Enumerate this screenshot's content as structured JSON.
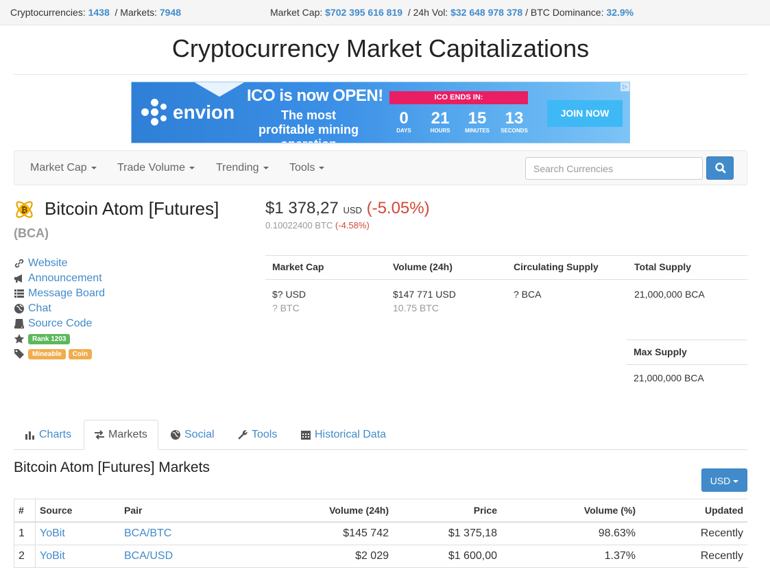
{
  "topbar": {
    "crypto_label": "Cryptocurrencies:",
    "crypto_count": "1438",
    "markets_label": "/ Markets:",
    "markets_count": "7948",
    "mcap_label": "Market Cap:",
    "mcap_value": "$702 395 616 819",
    "vol_label": "/ 24h Vol:",
    "vol_value": "$32 648 978 378",
    "dom_label": "/ BTC Dominance:",
    "dom_value": "32.9%"
  },
  "page_title": "Cryptocurrency Market Capitalizations",
  "banner": {
    "brand": "envion",
    "headline": "ICO is now OPEN!",
    "subline": "The most profitable mining operation",
    "ends_label": "ICO ENDS IN:",
    "countdown": [
      {
        "num": "0",
        "label": "DAYS"
      },
      {
        "num": "21",
        "label": "HOURS"
      },
      {
        "num": "15",
        "label": "MINUTES"
      },
      {
        "num": "13",
        "label": "SECONDS"
      }
    ],
    "cta": "JOIN NOW"
  },
  "nav": {
    "items": [
      "Market Cap",
      "Trade Volume",
      "Trending",
      "Tools"
    ],
    "search_placeholder": "Search Currencies"
  },
  "coin": {
    "name": "Bitcoin Atom [Futures]",
    "symbol": "(BCA)",
    "price_usd": "$1 378,27",
    "price_unit": "USD",
    "change_usd": "(-5.05%)",
    "price_btc": "0.10022400 BTC",
    "change_btc": "(-4.58%)",
    "links": [
      "Website",
      "Announcement",
      "Message Board",
      "Chat",
      "Source Code"
    ],
    "rank": "Rank 1203",
    "tags": [
      "Mineable",
      "Coin"
    ]
  },
  "stats": {
    "headers": [
      "Market Cap",
      "Volume (24h)",
      "Circulating Supply",
      "Total Supply"
    ],
    "market_cap_usd": "$? USD",
    "market_cap_btc": "? BTC",
    "volume_usd": "$147 771 USD",
    "volume_btc": "10.75 BTC",
    "circulating": "? BCA",
    "total": "21,000,000 BCA",
    "max_header": "Max Supply",
    "max": "21,000,000 BCA"
  },
  "tabs": [
    "Charts",
    "Markets",
    "Social",
    "Tools",
    "Historical Data"
  ],
  "markets_title": "Bitcoin Atom [Futures] Markets",
  "currency_button": "USD",
  "table": {
    "headers": [
      "#",
      "Source",
      "Pair",
      "Volume (24h)",
      "Price",
      "Volume (%)",
      "Updated"
    ],
    "rows": [
      {
        "n": "1",
        "source": "YoBit",
        "pair": "BCA/BTC",
        "volume": "$145 742",
        "price": "$1 375,18",
        "pct": "98.63%",
        "updated": "Recently"
      },
      {
        "n": "2",
        "source": "YoBit",
        "pair": "BCA/USD",
        "volume": "$2 029",
        "price": "$1 600,00",
        "pct": "1.37%",
        "updated": "Recently"
      }
    ]
  },
  "colors": {
    "link": "#428bca",
    "negative": "#d14836",
    "rank_badge": "#5cb85c",
    "tag_badge": "#f0ad4e"
  }
}
